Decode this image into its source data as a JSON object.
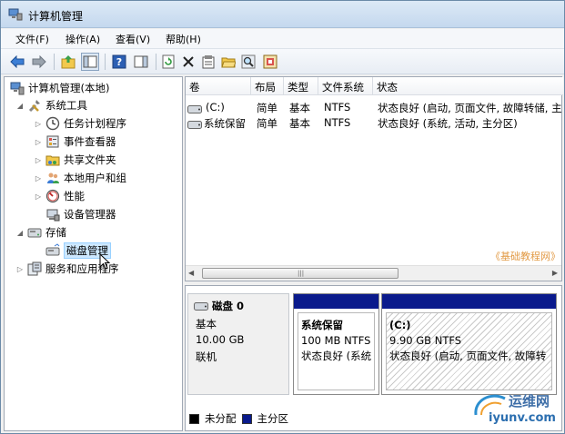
{
  "window": {
    "title": "计算机管理"
  },
  "menu": [
    "文件(F)",
    "操作(A)",
    "查看(V)",
    "帮助(H)"
  ],
  "toolbar": {
    "buttons": [
      "back-arrow-icon",
      "forward-arrow-icon",
      "up-folder-icon",
      "console-tree-icon",
      "help-icon",
      "action-pane-icon",
      "refresh-icon",
      "delete-icon",
      "properties-icon",
      "open-folder-icon",
      "search-icon",
      "export-icon"
    ]
  },
  "tree": {
    "root": "计算机管理(本地)",
    "system_tools": "系统工具",
    "task_scheduler": "任务计划程序",
    "event_viewer": "事件查看器",
    "shared_folders": "共享文件夹",
    "local_users": "本地用户和组",
    "performance": "性能",
    "device_manager": "设备管理器",
    "storage": "存储",
    "disk_management": "磁盘管理",
    "services_apps": "服务和应用程序"
  },
  "volume_list": {
    "columns": [
      "卷",
      "布局",
      "类型",
      "文件系统",
      "状态"
    ],
    "rows": [
      {
        "volume": "(C:)",
        "layout": "简单",
        "type": "基本",
        "fs": "NTFS",
        "status": "状态良好 (启动, 页面文件, 故障转储, 主"
      },
      {
        "volume": "系统保留",
        "layout": "简单",
        "type": "基本",
        "fs": "NTFS",
        "status": "状态良好 (系统, 活动, 主分区)"
      }
    ],
    "watermark": "《基础教程网》"
  },
  "disk": {
    "name": "磁盘 0",
    "type": "基本",
    "size": "10.00 GB",
    "state": "联机",
    "partitions": [
      {
        "name": "系统保留",
        "size": "100 MB NTFS",
        "status": "状态良好 (系统"
      },
      {
        "name": "(C:)",
        "size": "9.90 GB NTFS",
        "status": "状态良好 (启动, 页面文件, 故障转"
      }
    ]
  },
  "legend": [
    {
      "label": "未分配",
      "color": "#000000"
    },
    {
      "label": "主分区",
      "color": "#0a1a8c"
    }
  ],
  "logo": {
    "line1": "运维网",
    "line2": "iyunv.com"
  }
}
